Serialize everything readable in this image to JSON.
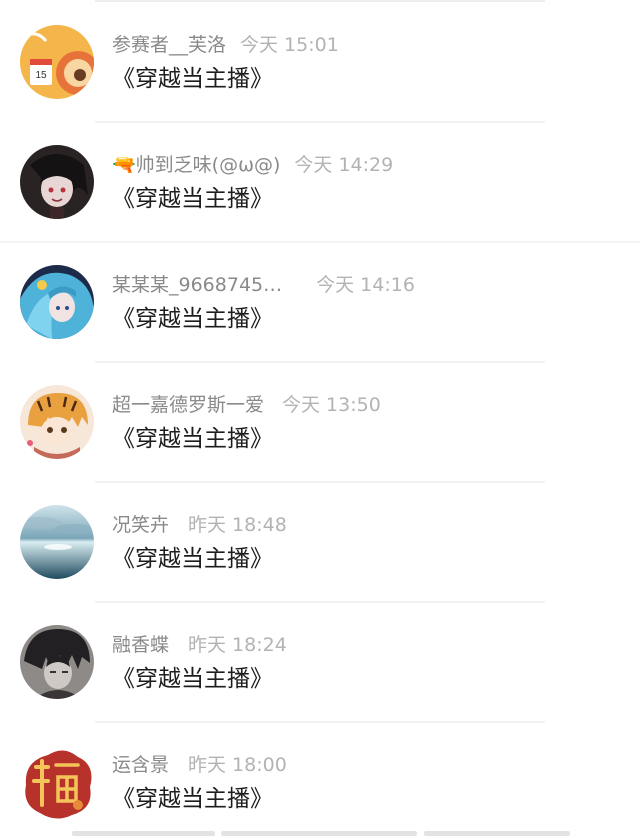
{
  "comments": [
    {
      "username": "参赛者__芙洛",
      "time": "今天 15:01",
      "content": "《穿越当主播》",
      "avatar": "calendar-orange-avatar"
    },
    {
      "username": "🔫帅到乏味(@ω@)",
      "time": "今天 14:29",
      "content": "《穿越当主播》",
      "avatar": "dark-anime-avatar"
    },
    {
      "username": "某某某_9668745…",
      "time": "今天 14:16",
      "content": "《穿越当主播》",
      "avatar": "blue-hair-anime-avatar"
    },
    {
      "username": "超一嘉德罗斯一爱",
      "time": "今天 13:50",
      "content": "《穿越当主播》",
      "avatar": "tiger-girl-avatar"
    },
    {
      "username": "况笑卉",
      "time": "昨天 18:48",
      "content": "《穿越当主播》",
      "avatar": "ocean-sky-avatar"
    },
    {
      "username": "融香蝶",
      "time": "昨天 18:24",
      "content": "《穿越当主播》",
      "avatar": "dark-hair-sketch-avatar"
    },
    {
      "username": "运含景",
      "time": "昨天 18:00",
      "content": "《穿越当主播》",
      "avatar": "fortune-character-avatar"
    }
  ],
  "colors": {
    "username": "#8a8a8a",
    "time": "#b3b3b3",
    "content": "#1d1d1d",
    "divider": "#f2f2f2"
  }
}
